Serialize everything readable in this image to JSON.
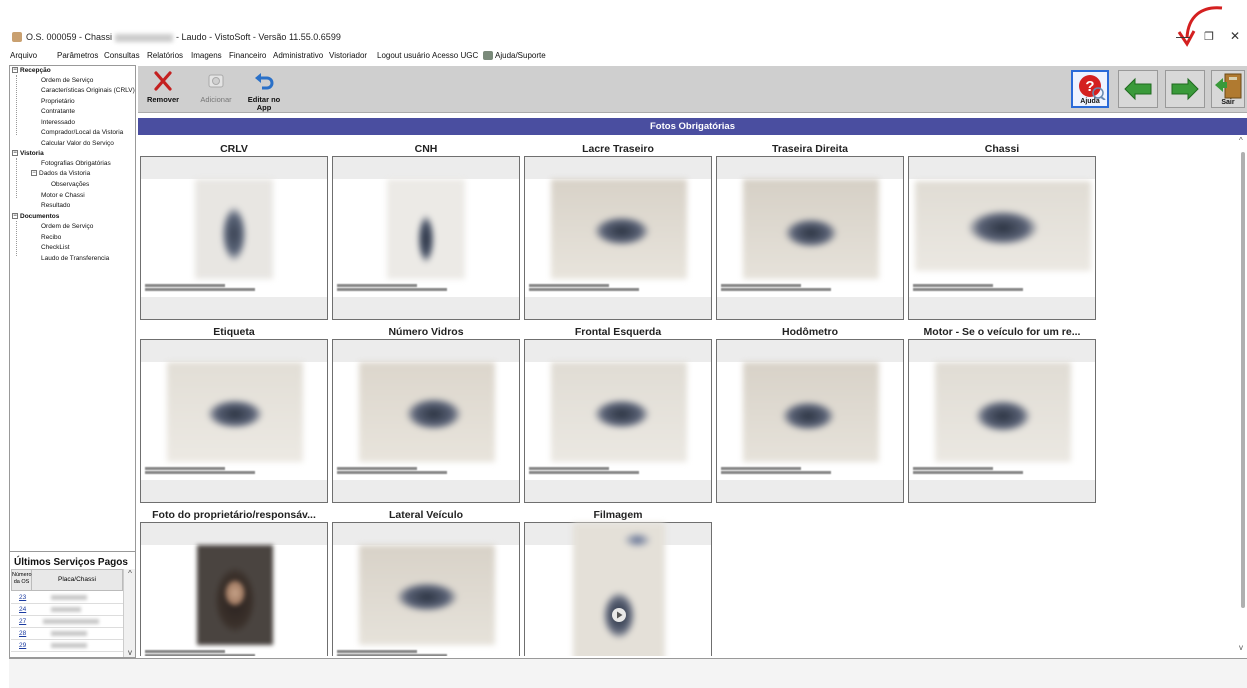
{
  "window": {
    "title_prefix": "O.S. 000059 - Chassi",
    "title_suffix": "- Laudo - VistoSoft - Versão 11.55.0.6599",
    "minimize": "—",
    "restore": "❐",
    "close": "✕"
  },
  "menu": [
    "Arquivo",
    "Parâmetros",
    "Consultas",
    "Relatórios",
    "Imagens",
    "Financeiro",
    "Administrativo",
    "Vistoriador",
    "Logout usuário",
    "Acesso UGC",
    "Ajuda/Suporte"
  ],
  "tree": {
    "recepcao": {
      "label": "Recepção",
      "items": [
        "Ordem de Serviço",
        "Características Originais (CRLV)",
        "Proprietário",
        "Contratante",
        "Interessado",
        "Comprador/Local da Vistoria",
        "Calcular Valor do Serviço"
      ]
    },
    "vistoria": {
      "label": "Vistoria",
      "items": [
        "Fotografias Obrigatórias",
        "Dados da Vistoria",
        "Observações",
        "Motor e Chassi",
        "Resultado"
      ]
    },
    "documentos": {
      "label": "Documentos",
      "items": [
        "Ordem de Serviço",
        "Recibo",
        "CheckList",
        "Laudo de Transferencia"
      ]
    }
  },
  "paid_services": {
    "title": "Últimos Serviços Pagos",
    "col_number": "Número da OS",
    "col_plate": "Placa/Chassi",
    "rows": [
      "23",
      "24",
      "27",
      "28",
      "29"
    ]
  },
  "toolbar": {
    "remove": "Remover",
    "add": "Adicionar",
    "edit_app": "Editar no App",
    "help": "Ajuda",
    "exit": "Sair"
  },
  "section_title": "Fotos Obrigatórias",
  "photos": [
    "CRLV",
    "CNH",
    "Lacre Traseiro",
    "Traseira Direita",
    "Chassi",
    "Etiqueta",
    "Número Vidros",
    "Frontal Esquerda",
    "Hodômetro",
    "Motor - Se o veículo for um re...",
    "Foto do proprietário/responsáv...",
    "Lateral Veículo",
    "Filmagem"
  ],
  "colors": {
    "section_header": "#4a4ea0",
    "toolbar_bg": "#cfcfcf",
    "link": "#1a3aa0",
    "arrow_green": "#3a9a3a",
    "annotation_red": "#d42020"
  }
}
